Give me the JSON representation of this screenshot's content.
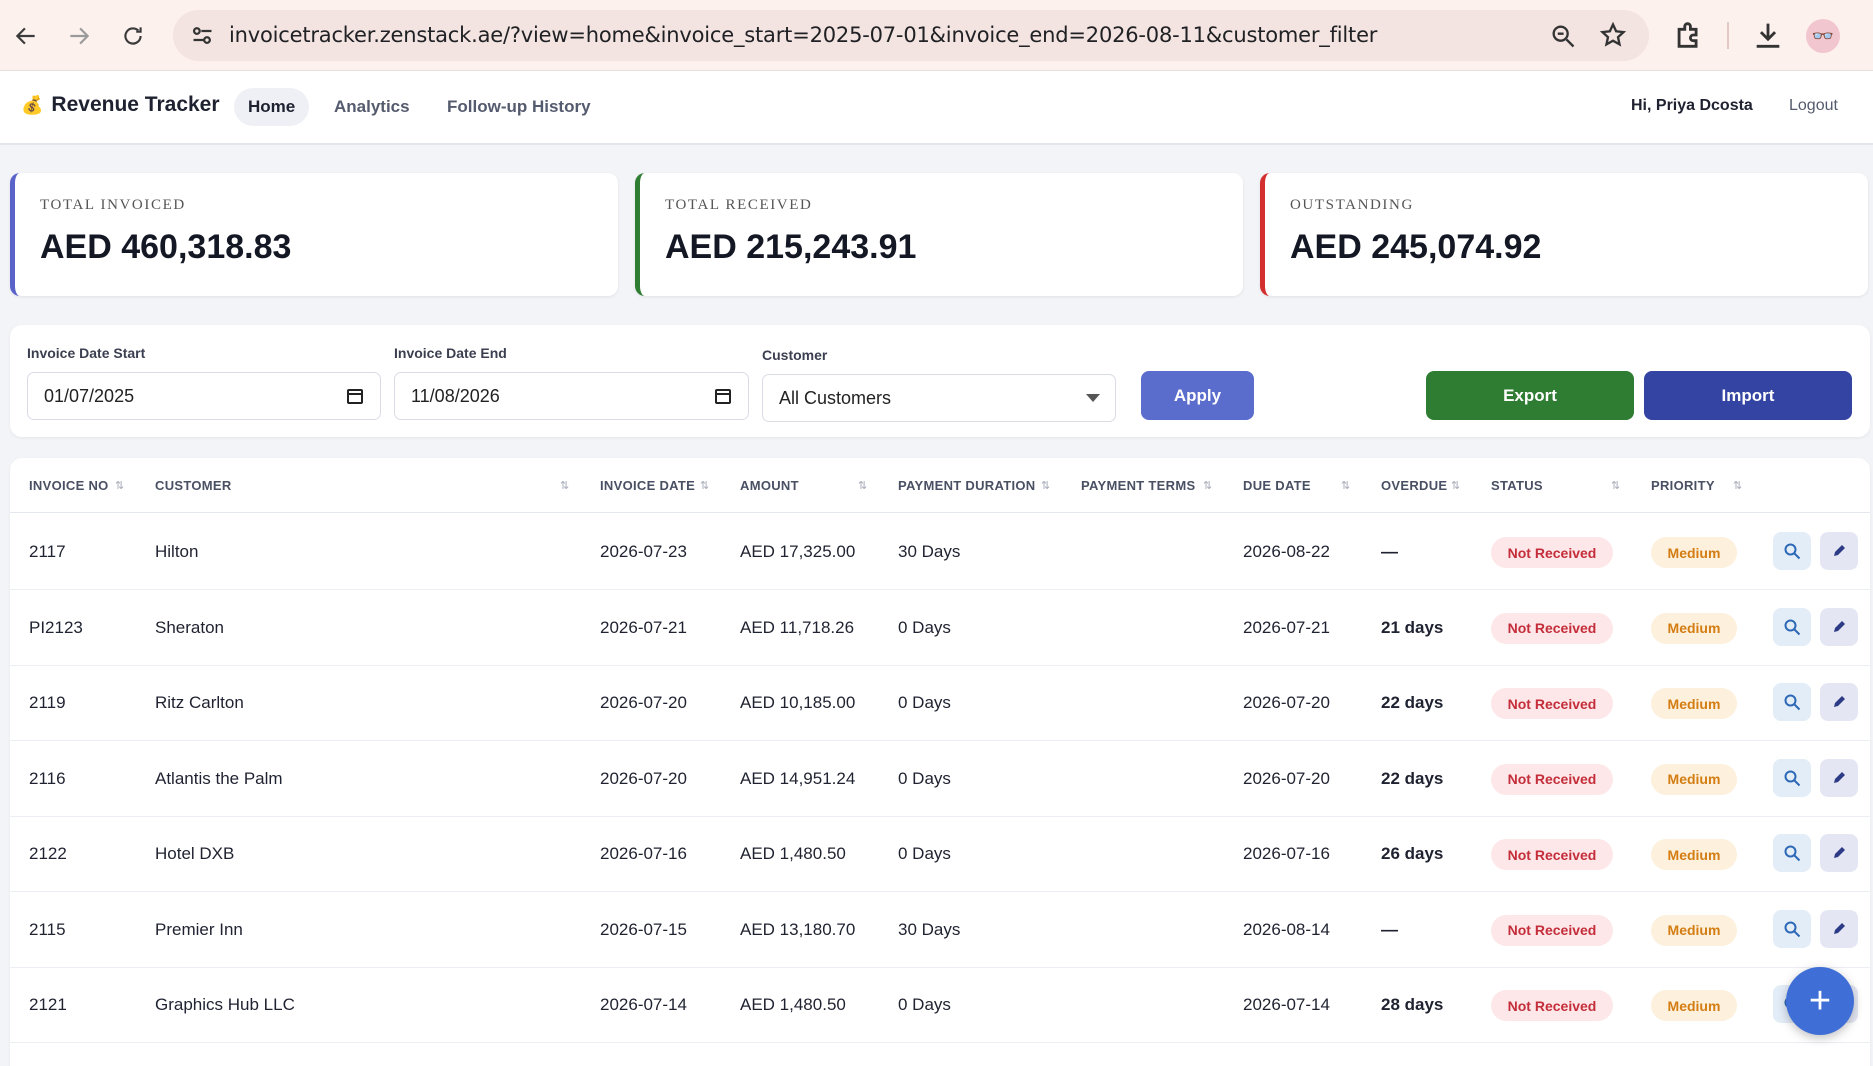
{
  "browser": {
    "url": "invoicetracker.zenstack.ae/?view=home&invoice_start=2025-07-01&invoice_end=2026-08-11&customer_filter"
  },
  "app": {
    "brand": "Revenue Tracker",
    "brand_icon": "💰",
    "nav": [
      "Home",
      "Analytics",
      "Follow-up History"
    ],
    "active_nav": "Home",
    "greeting": "Hi, Priya Dcosta",
    "logout": "Logout"
  },
  "summary": {
    "invoiced": {
      "label": "TOTAL INVOICED",
      "value": "AED 460,318.83",
      "color": "#5a63c9"
    },
    "received": {
      "label": "TOTAL RECEIVED",
      "value": "AED 215,243.91",
      "color": "#2e7d32"
    },
    "outstanding": {
      "label": "OUTSTANDING",
      "value": "AED 245,074.92",
      "color": "#d32f2f"
    }
  },
  "filters": {
    "start_label": "Invoice Date Start",
    "start_value": "01/07/2025",
    "end_label": "Invoice Date End",
    "end_value": "11/08/2026",
    "customer_label": "Customer",
    "customer_value": "All Customers",
    "apply": "Apply",
    "export": "Export",
    "import": "Import"
  },
  "table": {
    "headers": [
      "INVOICE NO",
      "CUSTOMER",
      "INVOICE DATE",
      "AMOUNT",
      "PAYMENT DURATION",
      "PAYMENT TERMS",
      "DUE DATE",
      "OVERDUE",
      "STATUS",
      "PRIORITY"
    ],
    "rows": [
      {
        "no": "2117",
        "customer": "Hilton",
        "date": "2026-07-23",
        "amount": "AED 17,325.00",
        "duration": "30 Days",
        "terms": "",
        "due": "2026-08-22",
        "overdue": "—",
        "status": "Not Received",
        "priority": "Medium"
      },
      {
        "no": "PI2123",
        "customer": "Sheraton",
        "date": "2026-07-21",
        "amount": "AED 11,718.26",
        "duration": "0 Days",
        "terms": "",
        "due": "2026-07-21",
        "overdue": "21 days",
        "status": "Not Received",
        "priority": "Medium"
      },
      {
        "no": "2119",
        "customer": "Ritz Carlton",
        "date": "2026-07-20",
        "amount": "AED 10,185.00",
        "duration": "0 Days",
        "terms": "",
        "due": "2026-07-20",
        "overdue": "22 days",
        "status": "Not Received",
        "priority": "Medium"
      },
      {
        "no": "2116",
        "customer": "Atlantis the Palm",
        "date": "2026-07-20",
        "amount": "AED 14,951.24",
        "duration": "0 Days",
        "terms": "",
        "due": "2026-07-20",
        "overdue": "22 days",
        "status": "Not Received",
        "priority": "Medium"
      },
      {
        "no": "2122",
        "customer": "Hotel DXB",
        "date": "2026-07-16",
        "amount": "AED 1,480.50",
        "duration": "0 Days",
        "terms": "",
        "due": "2026-07-16",
        "overdue": "26 days",
        "status": "Not Received",
        "priority": "Medium"
      },
      {
        "no": "2115",
        "customer": "Premier Inn",
        "date": "2026-07-15",
        "amount": "AED 13,180.70",
        "duration": "30 Days",
        "terms": "",
        "due": "2026-08-14",
        "overdue": "—",
        "status": "Not Received",
        "priority": "Medium"
      },
      {
        "no": "2121",
        "customer": "Graphics Hub LLC",
        "date": "2026-07-14",
        "amount": "AED 1,480.50",
        "duration": "0 Days",
        "terms": "",
        "due": "2026-07-14",
        "overdue": "28 days",
        "status": "Not Received",
        "priority": "Medium"
      }
    ]
  },
  "fab": "+"
}
